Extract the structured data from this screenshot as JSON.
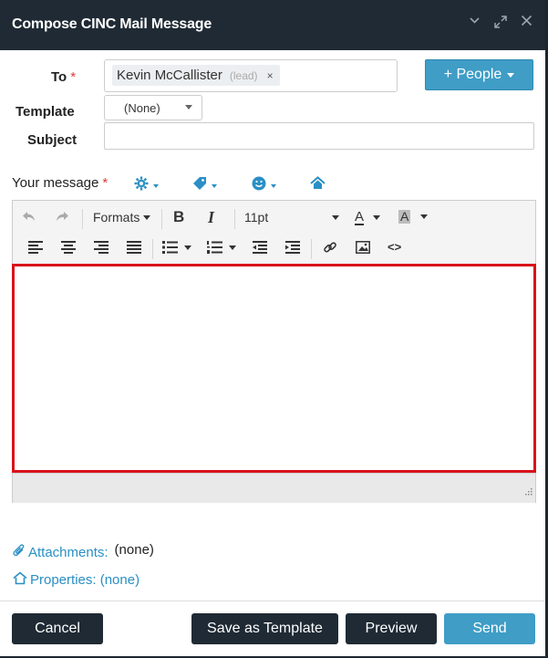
{
  "window": {
    "title": "Compose CINC Mail Message"
  },
  "fields": {
    "to_label": "To",
    "required_marker": "*",
    "recipient_name": "Kevin McCallister",
    "recipient_tag": "(lead)",
    "recipient_remove": "×",
    "people_button": "+ People",
    "template_label": "Template",
    "template_value": "(None)",
    "subject_label": "Subject",
    "subject_value": "",
    "message_label": "Your message"
  },
  "toolbar": {
    "formats_label": "Formats",
    "bold": "B",
    "italic": "I",
    "font_size": "11pt",
    "font_color": "A",
    "bg_color": "A",
    "source_code": "<>"
  },
  "attachments": {
    "label": "Attachments:",
    "value": "(none)"
  },
  "properties": {
    "label": "Properties: (none)"
  },
  "footer": {
    "cancel": "Cancel",
    "save_template": "Save as Template",
    "preview": "Preview",
    "send": "Send"
  },
  "colors": {
    "accent": "#3f9dc6",
    "dark": "#1f2a34",
    "link": "#2a8fc4",
    "focus_border": "#d9131b"
  }
}
